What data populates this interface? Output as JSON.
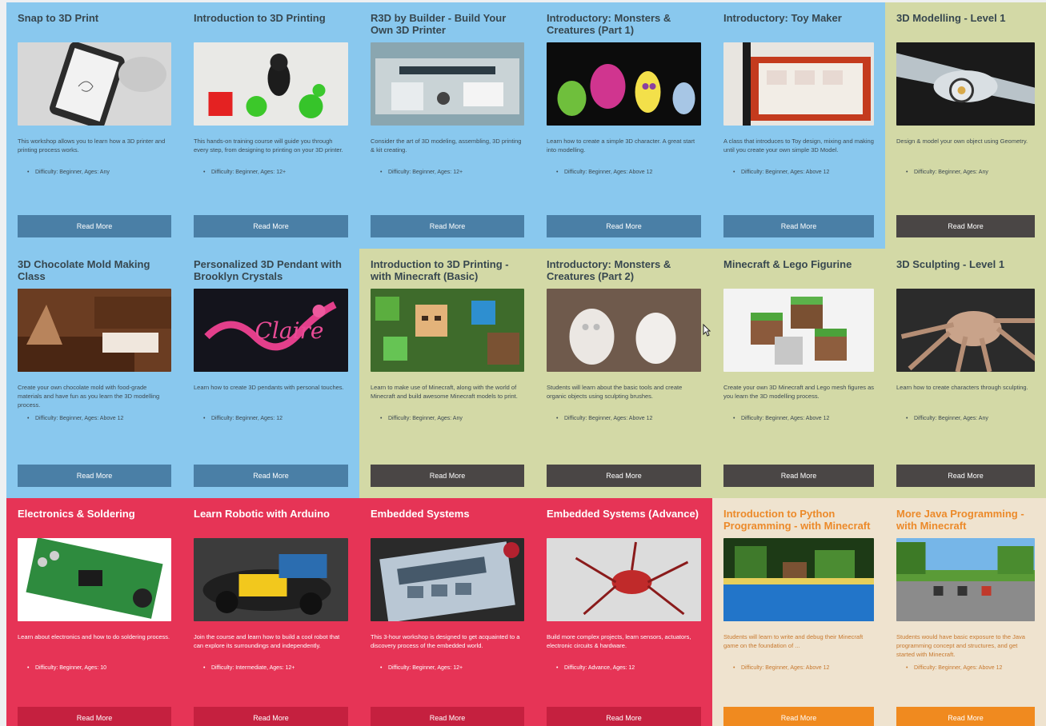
{
  "labels": {
    "read_more": "Read More"
  },
  "colors": {
    "blue": "#89c8ee",
    "sage": "#d3d9a6",
    "red": "#e63456",
    "cream": "#efe3cf",
    "blue_button": "#4a7fa6",
    "dark_button": "#4a4645",
    "red_button": "#c5203f",
    "orange_button": "#f08a1f"
  },
  "cards": [
    {
      "title": "Snap to 3D Print",
      "theme": "blue",
      "image": "sketching-tablet-photo",
      "description": "This workshop allows you to learn how a 3D printer and printing process works.",
      "meta": "Difficulty: Beginner, Ages: Any"
    },
    {
      "title": "Introduction to 3D Printing",
      "theme": "blue",
      "image": "printed-figurines-photo",
      "description": "This hands-on training course will guide you through every step, from designing to printing on your 3D printer.",
      "meta": "Difficulty: Beginner, Ages: 12+"
    },
    {
      "title": "R3D by Builder - Build Your Own 3D Printer",
      "theme": "blue",
      "image": "printer-kit-photo",
      "description": "Consider the art of 3D modeling, assembling, 3D printing & kit creating.",
      "meta": "Difficulty: Beginner, Ages: 12+"
    },
    {
      "title": "Introductory: Monsters & Creatures (Part 1)",
      "theme": "blue",
      "image": "monster-toys-photo",
      "description": "Learn how to create a simple 3D character. A great start into modelling.",
      "meta": "Difficulty: Beginner, Ages: Above 12"
    },
    {
      "title": "Introductory: Toy Maker",
      "theme": "blue",
      "image": "toy-maker-photo",
      "description": "A class that introduces to Toy design, mixing and making until you create your own simple 3D Model.",
      "meta": "Difficulty: Beginner, Ages: Above 12"
    },
    {
      "title": "3D Modelling - Level 1",
      "theme": "sage",
      "image": "airplane-model-photo",
      "description": "Design & model your own object using Geometry.",
      "meta": "Difficulty: Beginner, Ages: Any"
    },
    {
      "title": "3D Chocolate Mold Making Class",
      "theme": "blue",
      "image": "chocolate-mold-photo",
      "description": "Create your own chocolate mold with food-grade materials and have fun as you learn the 3D modelling process.",
      "meta": "Difficulty: Beginner, Ages: Above 12"
    },
    {
      "title": "Personalized 3D Pendant with Brooklyn Crystals",
      "theme": "blue",
      "image": "pendant-photo",
      "description": "Learn how to create 3D pendants with personal touches.",
      "meta": "Difficulty: Beginner, Ages: 12"
    },
    {
      "title": "Introduction to 3D Printing - with Minecraft (Basic)",
      "theme": "sage",
      "image": "minecraft-characters-photo",
      "description": "Learn to make use of Minecraft, along with the world of Minecraft and build awesome Minecraft models to print.",
      "meta": "Difficulty: Beginner, Ages: Any"
    },
    {
      "title": "Introductory: Monsters & Creatures (Part 2)",
      "theme": "sage",
      "image": "white-figurines-photo",
      "description": "Students will learn about the basic tools and create organic objects using sculpting brushes.",
      "meta": "Difficulty: Beginner, Ages: Above 12"
    },
    {
      "title": "Minecraft & Lego Figurine",
      "theme": "sage",
      "image": "minecraft-blocks-photo",
      "description": "Create your own 3D Minecraft and Lego mesh figures as you learn the 3D modelling process.",
      "meta": "Difficulty: Beginner, Ages: Above 12"
    },
    {
      "title": "3D Sculpting - Level 1",
      "theme": "sage",
      "image": "sculpted-spider-photo",
      "description": "Learn how to create characters through sculpting.",
      "meta": "Difficulty: Beginner, Ages: Any"
    },
    {
      "title": "Electronics & Soldering",
      "theme": "red",
      "image": "circuit-board-photo",
      "description": "Learn about electronics and how to do soldering process.",
      "meta": "Difficulty: Beginner, Ages: 10"
    },
    {
      "title": "Learn Robotic with Arduino",
      "theme": "red",
      "image": "arduino-robot-photo",
      "description": "Join the course and learn how to build a cool robot that can explore its surroundings and independently.",
      "meta": "Difficulty: Intermediate, Ages: 12+"
    },
    {
      "title": "Embedded Systems",
      "theme": "red",
      "image": "embedded-kit-photo",
      "description": "This 3-hour workshop is designed to get acquainted to a discovery process of the embedded world.",
      "meta": "Difficulty: Beginner, Ages: 12+"
    },
    {
      "title": "Embedded Systems (Advance)",
      "theme": "red",
      "image": "robot-spider-photo",
      "description": "Build more complex projects, learn sensors, actuators, electronic circuits & hardware.",
      "meta": "Difficulty: Advance, Ages: 12"
    },
    {
      "title": "Introduction to Python Programming - with Minecraft",
      "theme": "cream",
      "image": "minecraft-pool-photo",
      "description": "Students will learn to write and debug their Minecraft game on the foundation of ...",
      "meta": "Difficulty: Beginner, Ages: Above 12"
    },
    {
      "title": "More Java Programming - with Minecraft",
      "theme": "cream",
      "image": "minecraft-landscape-photo",
      "description": "Students would have basic exposure to the Java programming concept and structures, and get started with Minecraft.",
      "meta": "Difficulty: Beginner, Ages: Above 12"
    }
  ]
}
